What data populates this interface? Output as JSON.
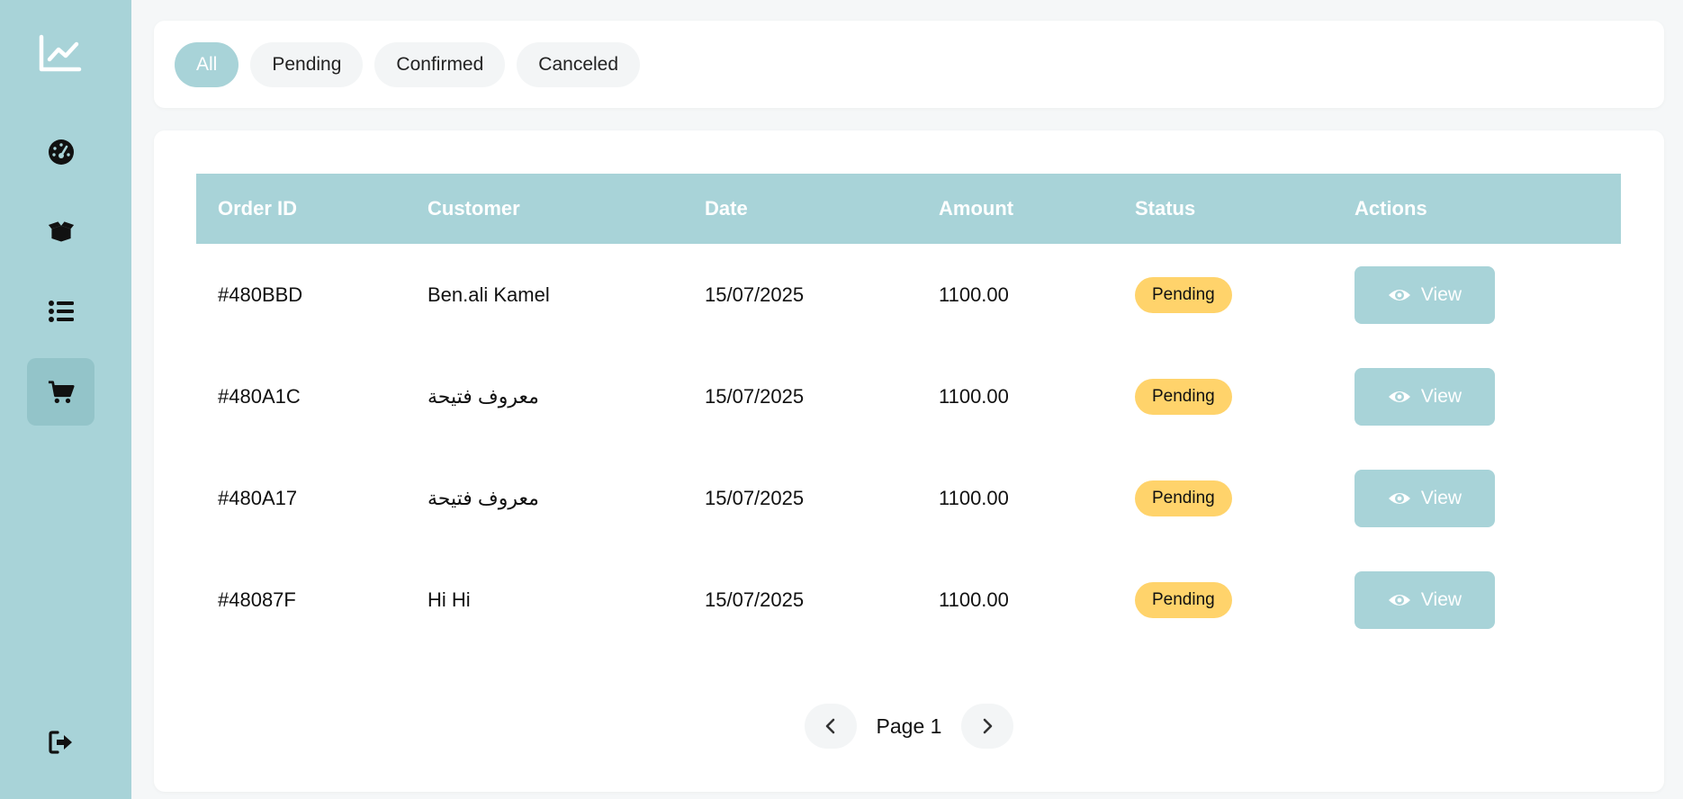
{
  "colors": {
    "accent": "#a8d3d8",
    "accent_active": "#93c4c9",
    "badge_pending": "#ffd36b",
    "icon_dark": "#111111"
  },
  "sidebar": {
    "logo_icon": "line-chart-icon",
    "items": [
      {
        "icon": "dashboard-gauge-icon",
        "active": false
      },
      {
        "icon": "box-open-icon",
        "active": false
      },
      {
        "icon": "list-icon",
        "active": false
      },
      {
        "icon": "shopping-cart-icon",
        "active": true
      }
    ],
    "logout_icon": "sign-out-icon"
  },
  "filters": [
    {
      "label": "All",
      "active": true
    },
    {
      "label": "Pending",
      "active": false
    },
    {
      "label": "Confirmed",
      "active": false
    },
    {
      "label": "Canceled",
      "active": false
    }
  ],
  "table": {
    "headers": [
      "Order ID",
      "Customer",
      "Date",
      "Amount",
      "Status",
      "Actions"
    ],
    "rows": [
      {
        "id": "#480BBD",
        "customer": "Ben.ali Kamel",
        "date": "15/07/2025",
        "amount": "1100.00",
        "status": "Pending",
        "action": "View"
      },
      {
        "id": "#480A1C",
        "customer": "معروف فتيحة",
        "date": "15/07/2025",
        "amount": "1100.00",
        "status": "Pending",
        "action": "View"
      },
      {
        "id": "#480A17",
        "customer": "معروف فتيحة",
        "date": "15/07/2025",
        "amount": "1100.00",
        "status": "Pending",
        "action": "View"
      },
      {
        "id": "#48087F",
        "customer": "Hi Hi",
        "date": "15/07/2025",
        "amount": "1100.00",
        "status": "Pending",
        "action": "View"
      }
    ]
  },
  "pagination": {
    "label": "Page 1",
    "prev_icon": "chevron-left-icon",
    "next_icon": "chevron-right-icon"
  }
}
